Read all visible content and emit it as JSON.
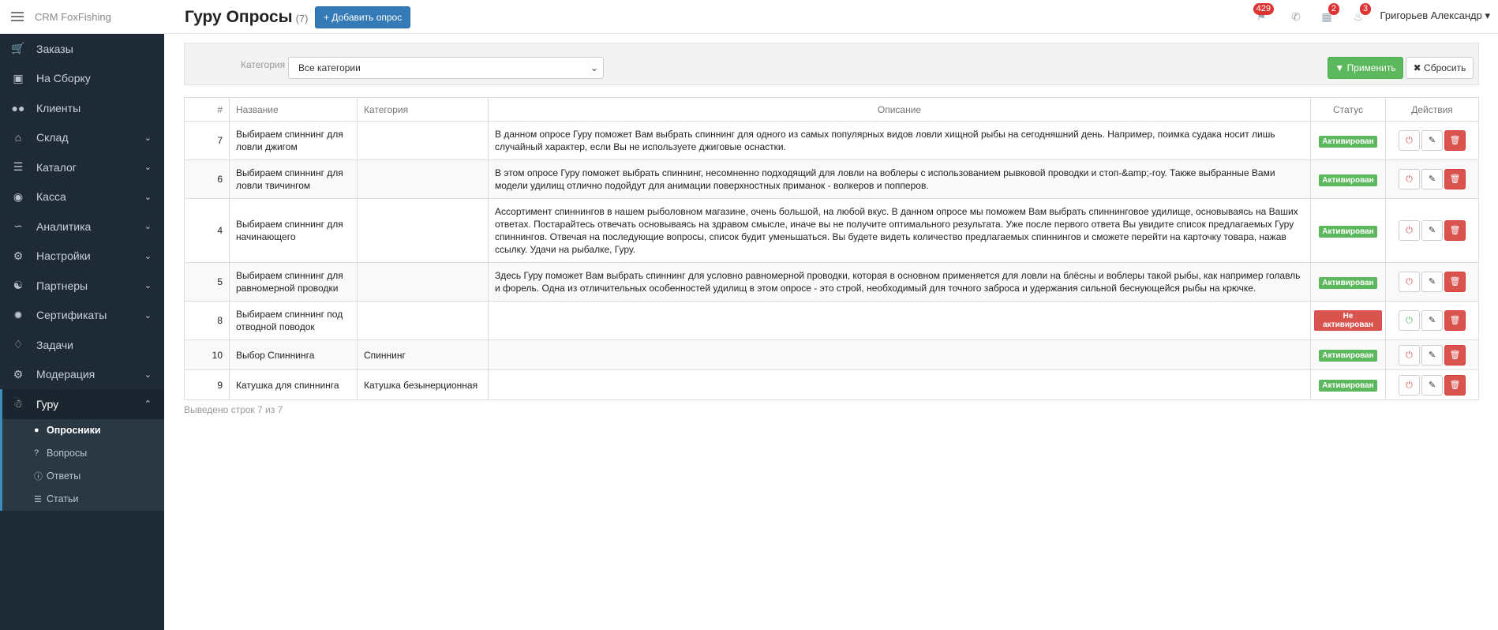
{
  "app": {
    "brand": "CRM FoxFishing"
  },
  "sidebar": {
    "items": [
      {
        "label": "Заказы",
        "icon": "cart-icon"
      },
      {
        "label": "На Сборку",
        "icon": "archive-icon"
      },
      {
        "label": "Клиенты",
        "icon": "users-icon"
      },
      {
        "label": "Склад",
        "icon": "home-icon"
      },
      {
        "label": "Каталог",
        "icon": "list-icon"
      },
      {
        "label": "Касса",
        "icon": "money-icon"
      },
      {
        "label": "Аналитика",
        "icon": "chart-icon"
      },
      {
        "label": "Настройки",
        "icon": "gears-icon"
      },
      {
        "label": "Партнеры",
        "icon": "handshake-icon"
      },
      {
        "label": "Сертификаты",
        "icon": "certificate-icon"
      },
      {
        "label": "Задачи",
        "icon": "tag-icon"
      },
      {
        "label": "Модерация",
        "icon": "gears-icon"
      },
      {
        "label": "Гуру",
        "icon": "walker-icon"
      }
    ],
    "sub_items": [
      {
        "label": "Опросники",
        "icon": "comments-icon"
      },
      {
        "label": "Вопросы",
        "icon": "question-icon"
      },
      {
        "label": "Ответы",
        "icon": "question-circle-icon"
      },
      {
        "label": "Статьи",
        "icon": "list-icon"
      }
    ]
  },
  "header": {
    "title": "Гуру Опросы",
    "count": "(7)",
    "add_button": "+ Добавить опрос",
    "messages_badge": "429",
    "calendar_badge": "2",
    "bell_badge": "3",
    "user": "Григорьев Александр"
  },
  "filter": {
    "category_label": "Категория",
    "category_value": "Все категории",
    "apply": "Применить",
    "reset": "Сбросить"
  },
  "table": {
    "headers": [
      "#",
      "Название",
      "Категория",
      "Описание",
      "Статус",
      "Действия"
    ],
    "rows": [
      {
        "id": "7",
        "name": "Выбираем спиннинг для ловли джигом",
        "category": "",
        "description": "В данном опросе Гуру поможет Вам выбрать спиннинг для одного из самых популярных видов ловли хищной рыбы на сегодняшний день. Например, поимка судака носит лишь случайный характер, если Вы не используете джиговые оснастки.",
        "status": "Активирован"
      },
      {
        "id": "6",
        "name": "Выбираем спиннинг для ловли твичингом",
        "category": "",
        "description": "В этом опросе Гуру поможет выбрать спиннинг, несомненно подходящий для ловли на воблеры с использованием рывковой проводки и стоп-&amp;-гоу. Также выбранные Вами модели удилищ отлично подойдут для анимации поверхностных приманок - волкеров и попперов.",
        "status": "Активирован"
      },
      {
        "id": "4",
        "name": "Выбираем спиннинг для начинающего",
        "category": "",
        "description": "Ассортимент спиннингов в нашем рыболовном магазине, очень большой, на любой вкус. В данном опросе мы поможем Вам выбрать спиннинговое удилище, основываясь на Ваших ответах. Постарайтесь отвечать основываясь на здравом смысле, иначе вы не получите оптимального результата. Уже после первого ответа Вы увидите список предлагаемых Гуру спиннингов. Отвечая на последующие вопросы, список будит уменьшаться. Вы будете видеть количество предлагаемых спиннингов и сможете перейти на карточку товара, нажав ссылку. Удачи на рыбалке, Гуру.",
        "status": "Активирован"
      },
      {
        "id": "5",
        "name": "Выбираем спиннинг для равномерной проводки",
        "category": "",
        "description": "Здесь Гуру поможет Вам выбрать спиннинг для условно равномерной проводки, которая в основном применяется для ловли на блёсны и воблеры такой рыбы, как например голавль и форель. Одна из отличительных особенностей удилищ в этом опросе - это строй, необходимый для точного заброса и удержания сильной беснующейся рыбы на крючке.",
        "status": "Активирован"
      },
      {
        "id": "8",
        "name": "Выбираем спиннинг под отводной поводок",
        "category": "",
        "description": "",
        "status": "Не активирован"
      },
      {
        "id": "10",
        "name": "Выбор Спиннинга",
        "category": "Спиннинг",
        "description": "",
        "status": "Активирован"
      },
      {
        "id": "9",
        "name": "Катушка для спиннинга",
        "category": "Катушка безынерционная",
        "description": "",
        "status": "Активирован"
      }
    ]
  },
  "footer_note": "Выведено строк 7 из 7",
  "colors": {
    "sidebar": "#1e2b37",
    "primary": "#337ab7",
    "success": "#5cb85c",
    "danger": "#d9534f"
  }
}
